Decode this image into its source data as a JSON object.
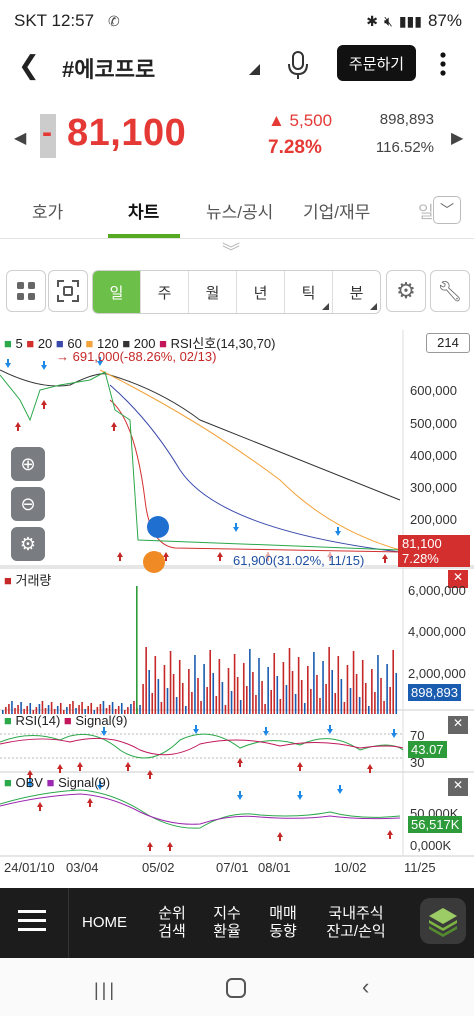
{
  "status": {
    "carrier": "SKT",
    "time": "12:57",
    "battery": "87%"
  },
  "header": {
    "title": "#에코프로",
    "order_label": "주문하기",
    "mic_icon": "mic-icon",
    "more_icon": "more-icon"
  },
  "quote": {
    "sign": "-",
    "price": "81,100",
    "change": "▲ 5,500",
    "change_pct": "7.28%",
    "volume": "898,893",
    "volume_ratio": "116.52%",
    "color_up": "#e53935"
  },
  "tabs": [
    "호가",
    "차트",
    "뉴스/공시",
    "기업/재무",
    "일"
  ],
  "active_tab": "차트",
  "toolbar": {
    "periods": [
      "일",
      "주",
      "월",
      "년",
      "틱",
      "분"
    ],
    "active_period": "일",
    "count": "214"
  },
  "chart": {
    "legend": {
      "ma5": "5",
      "ma20": "20",
      "ma60": "60",
      "ma120": "120",
      "ma200": "200",
      "rsi_signal": "RSI신호(14,30,70)",
      "high_note": "→ 691,000(-88.26%, 02/13)",
      "low_note": "61,900(31.02%, 11/15)"
    },
    "price_axis": [
      "600,000",
      "500,000",
      "400,000",
      "300,000",
      "200,000"
    ],
    "price_badge": "81,100",
    "price_badge_pct": "7.28%",
    "volume_label": "거래량",
    "volume_axis": [
      "6,000,000",
      "4,000,000",
      "2,000,000"
    ],
    "volume_badge": "898,893",
    "rsi_label": "RSI(14)",
    "rsi_signal_label": "Signal(9)",
    "rsi_axis": [
      "70",
      "30"
    ],
    "rsi_badge": "43.07",
    "obv_label": "OBV",
    "obv_signal_label": "Signal(9)",
    "obv_axis": [
      "50,000K",
      "56,517K",
      "0,000K"
    ],
    "obv_badge": "56,517K",
    "dates": [
      "24/01/10",
      "03/04",
      "05/02",
      "07/01",
      "08/01",
      "10/02",
      "11/25"
    ],
    "colors": {
      "ma5": "#2aa84a",
      "ma20": "#d32f2f",
      "ma60": "#3949ab",
      "ma120": "#f2a33a",
      "ma200": "#333333",
      "rsi": "#c2185b"
    }
  },
  "bottom_nav": {
    "home": "HOME",
    "items": [
      [
        "순위",
        "검색"
      ],
      [
        "지수",
        "환율"
      ],
      [
        "매매",
        "동향"
      ],
      [
        "국내주식",
        "잔고/손익"
      ]
    ]
  }
}
